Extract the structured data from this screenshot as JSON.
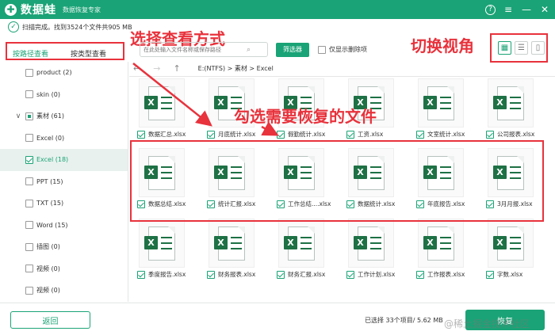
{
  "app": {
    "name": "数据蛙",
    "logo_char": "✚",
    "subtitle": "数据恢复专家"
  },
  "window": {
    "help": "?",
    "menu": "≡",
    "minimize": "—",
    "close": "✕"
  },
  "scan_status": "扫描完成。找到3524个文件共905 MB",
  "annotations": {
    "view_mode": "选择查看方式",
    "switch_view": "切换视角",
    "check_files": "勾选需要恢复的文件"
  },
  "tabs": [
    {
      "label": "按路径查看"
    },
    {
      "label": "按类型查看"
    }
  ],
  "search": {
    "placeholder": "在此处输入文件名称或保存路径"
  },
  "filter_button": "筛选器",
  "deleted_only": "仅显示删除项",
  "view_buttons": [
    "▦",
    "☰",
    "▯"
  ],
  "nav": {
    "back": "←",
    "forward": "→",
    "up": "↑",
    "path": "E:(NTFS) > 素材 > Excel"
  },
  "tree": [
    {
      "label": "product (2)",
      "level": 2,
      "checked": "none",
      "toggle": "",
      "selected": false
    },
    {
      "label": "skin (0)",
      "level": 2,
      "checked": "none",
      "toggle": "",
      "selected": false
    },
    {
      "label": "素材 (61)",
      "level": 1,
      "checked": "partial",
      "toggle": "∨",
      "selected": false
    },
    {
      "label": "Excel (0)",
      "level": 2,
      "checked": "none",
      "toggle": "",
      "selected": false
    },
    {
      "label": "Excel (18)",
      "level": 2,
      "checked": "checked",
      "toggle": "",
      "selected": true
    },
    {
      "label": "PPT (15)",
      "level": 2,
      "checked": "none",
      "toggle": "",
      "selected": false
    },
    {
      "label": "TXT (15)",
      "level": 2,
      "checked": "none",
      "toggle": "",
      "selected": false
    },
    {
      "label": "Word (15)",
      "level": 2,
      "checked": "none",
      "toggle": "",
      "selected": false
    },
    {
      "label": "插图 (0)",
      "level": 2,
      "checked": "none",
      "toggle": "",
      "selected": false
    },
    {
      "label": "视频 (0)",
      "level": 2,
      "checked": "none",
      "toggle": "",
      "selected": false
    },
    {
      "label": "视频 (0)",
      "level": 2,
      "checked": "none",
      "toggle": "",
      "selected": false
    }
  ],
  "files": [
    {
      "name": "数据汇总.xlsx",
      "checked": true
    },
    {
      "name": "月底统计.xlsx",
      "checked": true
    },
    {
      "name": "假勤统计.xlsx",
      "checked": true
    },
    {
      "name": "工资.xlsx",
      "checked": true
    },
    {
      "name": "文室统计.xlsx",
      "checked": true
    },
    {
      "name": "公司报表.xlsx",
      "checked": true
    },
    {
      "name": "数据总结.xlsx",
      "checked": true
    },
    {
      "name": "统计汇报.xlsx",
      "checked": true
    },
    {
      "name": "工作总结....xlsx",
      "checked": true
    },
    {
      "name": "数据统计.xlsx",
      "checked": true
    },
    {
      "name": "年底报告.xlsx",
      "checked": true
    },
    {
      "name": "3月月报.xlsx",
      "checked": true
    },
    {
      "name": "季度报告.xlsx",
      "checked": true
    },
    {
      "name": "财务报表.xlsx",
      "checked": true
    },
    {
      "name": "财务汇报.xlsx",
      "checked": true
    },
    {
      "name": "工作计划.xlsx",
      "checked": true
    },
    {
      "name": "工作报表.xlsx",
      "checked": true
    },
    {
      "name": "字数.xlsx",
      "checked": true
    }
  ],
  "footer": {
    "back": "返回",
    "selected": "已选择 33个项目/ 5.62 MB",
    "recover": "恢复"
  },
  "watermark": "@稀土掘金技术社区",
  "colors": {
    "brand": "#1aa376",
    "annotation": "#e8323c",
    "excel": "#1e7145"
  }
}
